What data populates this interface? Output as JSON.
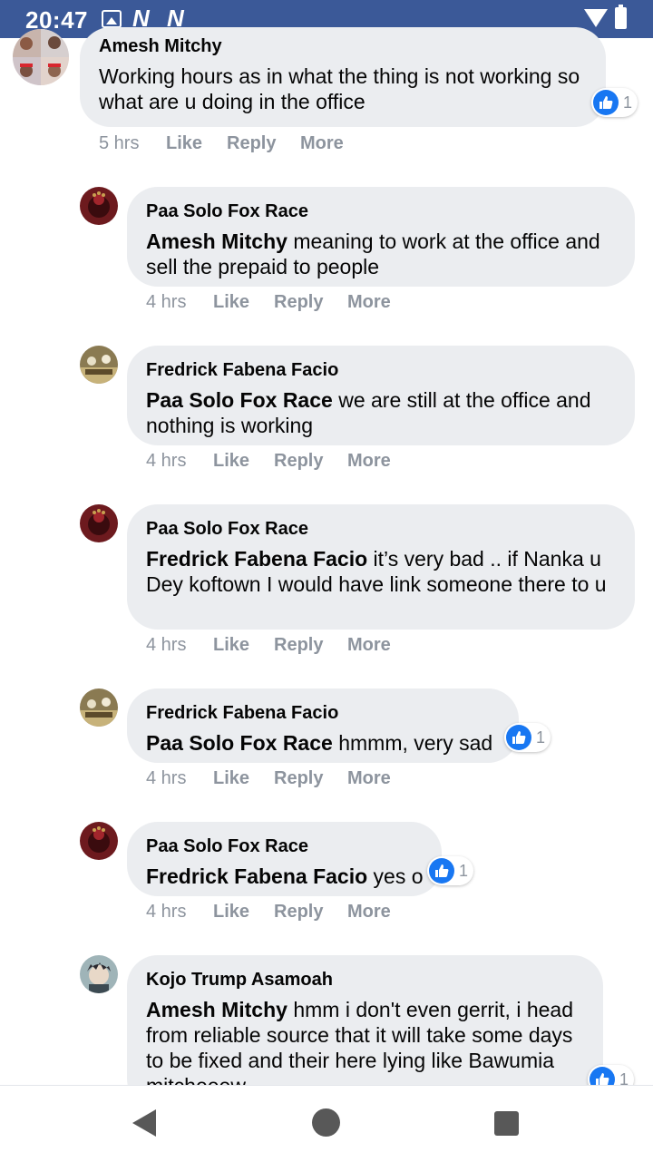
{
  "status_bar": {
    "time": "20:47",
    "notification_icons": [
      "image-icon",
      "n-app-icon",
      "n-app-icon"
    ],
    "system_icons": [
      "wifi-icon",
      "battery-icon"
    ],
    "background": "#3b5998"
  },
  "comments": [
    {
      "author": "Amesh Mitchy",
      "mention": "",
      "text": "Working hours as in what the thing is not working so what are u doing in the office",
      "time": "5 hrs",
      "reactions": "1",
      "avatar": "collage"
    },
    {
      "author": "Paa Solo Fox Race",
      "mention": "Amesh Mitchy",
      "text": " meaning to work at the office and sell the prepaid to people",
      "time": "4 hrs",
      "reactions": "",
      "avatar": "lion"
    },
    {
      "author": "Fredrick Fabena Facio",
      "mention": "Paa Solo Fox Race",
      "text": " we are still at the office and nothing is working",
      "time": "4 hrs",
      "reactions": "",
      "avatar": "photo"
    },
    {
      "author": "Paa Solo Fox Race",
      "mention": "Fredrick Fabena Facio",
      "text": " it’s very bad .. if Nanka u Dey koftown I would have link someone there to u",
      "time": "4 hrs",
      "reactions": "",
      "avatar": "lion"
    },
    {
      "author": "Fredrick Fabena Facio",
      "mention": "Paa Solo Fox Race",
      "text": " hmmm, very sad",
      "time": "4 hrs",
      "reactions": "1",
      "avatar": "photo"
    },
    {
      "author": "Paa Solo Fox Race",
      "mention": "Fredrick Fabena Facio",
      "text": " yes o",
      "time": "4 hrs",
      "reactions": "1",
      "avatar": "lion"
    },
    {
      "author": "Kojo Trump Asamoah",
      "mention": "Amesh Mitchy",
      "text": " hmm i don't even gerrit, i head from reliable source that it will take some days to be fixed and their here lying like Bawumia mitcheeew",
      "time": "",
      "reactions": "1",
      "avatar": "anime"
    }
  ],
  "actions": {
    "like": "Like",
    "reply": "Reply",
    "more": "More"
  },
  "colors": {
    "bubble": "#ebedf0",
    "meta": "#8d949e",
    "like_blue": "#1877f2"
  },
  "nav_bar": {
    "icons": [
      "back-icon",
      "home-icon",
      "recents-icon"
    ]
  }
}
